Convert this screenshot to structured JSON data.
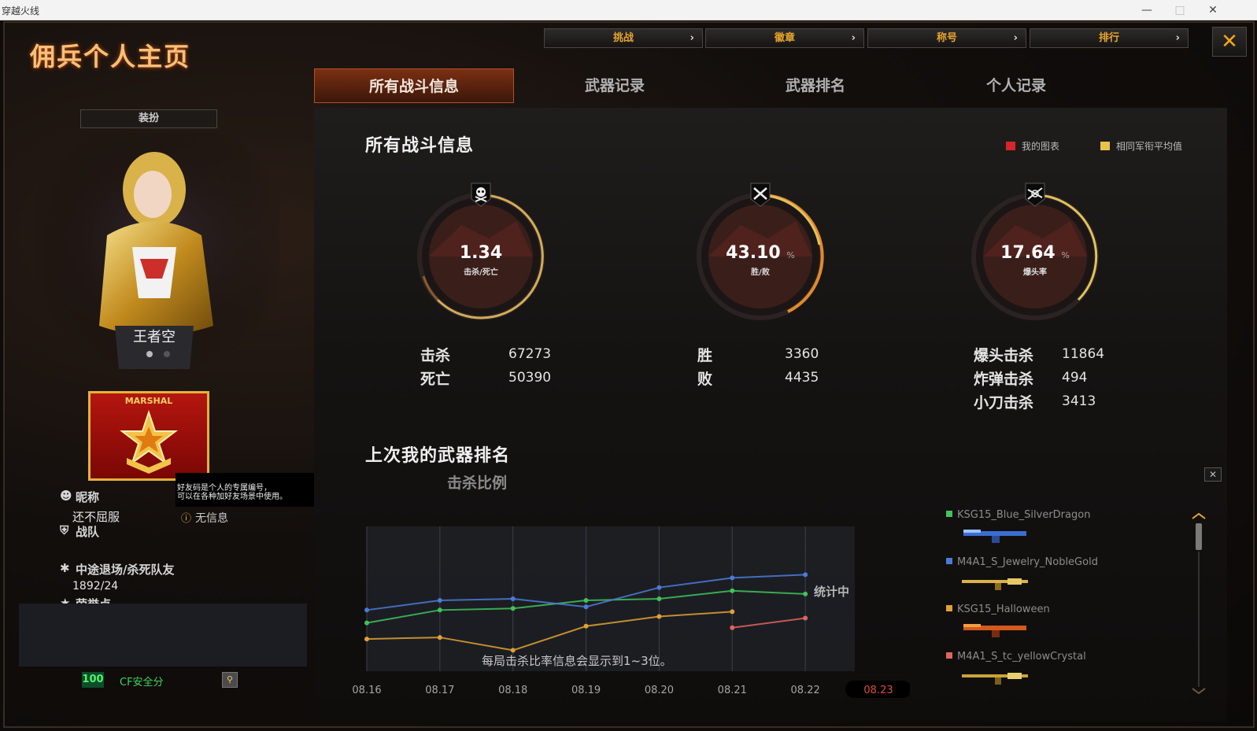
{
  "os_window": {
    "title": "穿越火线"
  },
  "header": {
    "title": "佣兵个人主页",
    "nav": [
      {
        "label": "挑战"
      },
      {
        "label": "徽章"
      },
      {
        "label": "称号"
      },
      {
        "label": "排行"
      }
    ],
    "close_icon": "close-icon"
  },
  "tabs": [
    {
      "label": "所有战斗信息",
      "active": true
    },
    {
      "label": "武器记录",
      "active": false
    },
    {
      "label": "武器排名",
      "active": false
    },
    {
      "label": "个人记录",
      "active": false
    }
  ],
  "profile": {
    "dress_button": "装扮",
    "character_name": "王者空",
    "rank_text": "MARSHAL",
    "tooltip": [
      "好友码是个人的专属编号，",
      "可以在各种加好友场景中使用。"
    ],
    "nickname_label": "昵称",
    "nickname_value": "还不屈服",
    "friend_code_value": "无信息",
    "clan_label": "战队",
    "quit_label": "中途退场/杀死队友",
    "quit_value": "1892/24",
    "honor_label": "荣誉点",
    "security_score": "100",
    "security_label": "CF安全分"
  },
  "colors": {
    "accent": "#e7a52e",
    "active_tab": "#7b2f13",
    "security_green": "#3ed65a"
  },
  "battle_info": {
    "title": "所有战斗信息",
    "legend": [
      {
        "label": "我的图表",
        "color": "#d6262a"
      },
      {
        "label": "相同军衔平均值",
        "color": "#e9c24a"
      }
    ],
    "gauges": [
      {
        "value": "1.34",
        "unit": "",
        "label": "击杀/死亡",
        "icon": "skull-icon"
      },
      {
        "value": "43.10",
        "unit": "%",
        "label": "胜/败",
        "icon": "crossed-swords-icon"
      },
      {
        "value": "17.64",
        "unit": "%",
        "label": "爆头率",
        "icon": "crossed-rifles-icon"
      }
    ],
    "kd": [
      {
        "label": "击杀",
        "value": "67273"
      },
      {
        "label": "死亡",
        "value": "50390"
      }
    ],
    "wl": [
      {
        "label": "胜",
        "value": "3360"
      },
      {
        "label": "败",
        "value": "4435"
      }
    ],
    "special": [
      {
        "label": "爆头击杀",
        "value": "11864"
      },
      {
        "label": "炸弹击杀",
        "value": "494"
      },
      {
        "label": "小刀击杀",
        "value": "3413"
      }
    ]
  },
  "weapon_rank": {
    "title": "上次我的武器排名",
    "subtitle": "击杀比例",
    "status": "统计中",
    "note": "每局击杀比率信息会显示到1~3位。",
    "weapons": [
      {
        "name": "KSG15_Blue_SilverDragon",
        "color": "#3fc35a"
      },
      {
        "name": "M4A1_S_Jewelry_NobleGold",
        "color": "#4a7bd8"
      },
      {
        "name": "KSG15_Halloween",
        "color": "#e0a134"
      },
      {
        "name": "M4A1_S_tc_yellowCrystal",
        "color": "#e0655a"
      }
    ]
  },
  "chart_data": {
    "type": "line",
    "x": [
      "08.16",
      "08.17",
      "08.18",
      "08.19",
      "08.20",
      "08.21",
      "08.22",
      "08.23"
    ],
    "selected_x": "08.23",
    "series": [
      {
        "name": "KSG15_Blue_SilverDragon",
        "color": "#3fc35a",
        "values": [
          3.0,
          3.8,
          3.9,
          4.4,
          4.5,
          5.0,
          4.8,
          null
        ]
      },
      {
        "name": "M4A1_S_Jewelry_NobleGold",
        "color": "#4a7bd8",
        "values": [
          3.8,
          4.4,
          4.5,
          4.0,
          5.2,
          5.8,
          6.0,
          null
        ]
      },
      {
        "name": "KSG15_Halloween",
        "color": "#e0a134",
        "values": [
          2.0,
          2.1,
          1.3,
          2.8,
          3.4,
          3.7,
          null,
          null
        ]
      },
      {
        "name": "M4A1_S_tc_yellowCrystal",
        "color": "#e0655a",
        "values": [
          null,
          null,
          null,
          null,
          null,
          2.7,
          3.3,
          null
        ]
      }
    ],
    "ylim": [
      0,
      9
    ],
    "grid": true
  }
}
